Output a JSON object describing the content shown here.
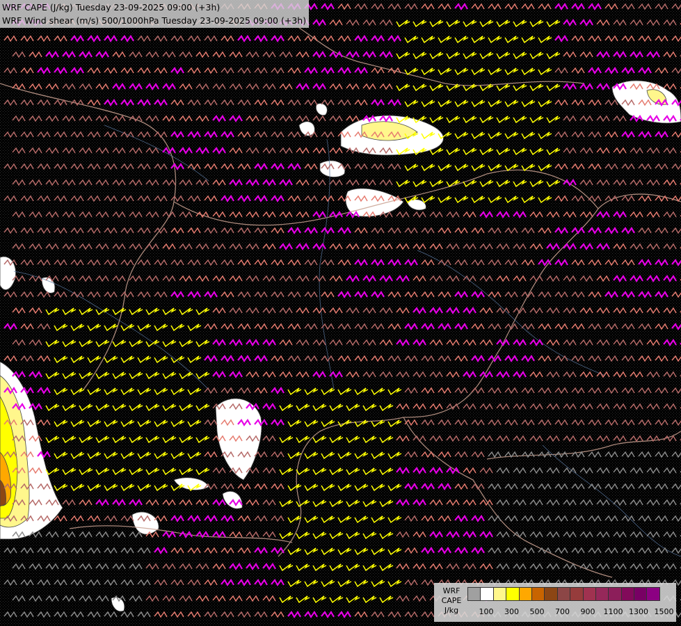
{
  "header": {
    "title_line_1": "WRF CAPE (J/kg) Tuesday 23-09-2025 09:00 (+3h)",
    "title_line_2": "WRF Wind shear (m/s) 500/1000hPa Tuesday 23-09-2025 09:00 (+3h)"
  },
  "legend": {
    "label_line_1": "WRF",
    "label_line_2": "CAPE",
    "label_line_3": "J/kg",
    "colors": [
      "#a0a0a0",
      "#ffffff",
      "#fff78c",
      "#ffff00",
      "#ffa800",
      "#c86400",
      "#8c4614",
      "#8c4646",
      "#963c3c",
      "#a03250",
      "#96285a",
      "#8c1e5a",
      "#820a5a",
      "#780064",
      "#8c0082"
    ],
    "ticks": [
      "100",
      "300",
      "500",
      "700",
      "900",
      "1100",
      "1300",
      "1500"
    ]
  },
  "map_colors": {
    "background": "#000000",
    "cape_fill": "#ffffff",
    "cape_low": "#fff78c",
    "cape_mid": "#ffff00",
    "cape_high": "#ffa800",
    "cape_very_high": "#8c4614",
    "barb_magenta": "#e600e6",
    "barb_salmon": "#e67c70",
    "barb_rose": "#b56a68",
    "barb_yellow": "#ffff00",
    "barb_grey": "#8a8a8a",
    "border": "#c8a090",
    "river": "#5a78a0"
  }
}
